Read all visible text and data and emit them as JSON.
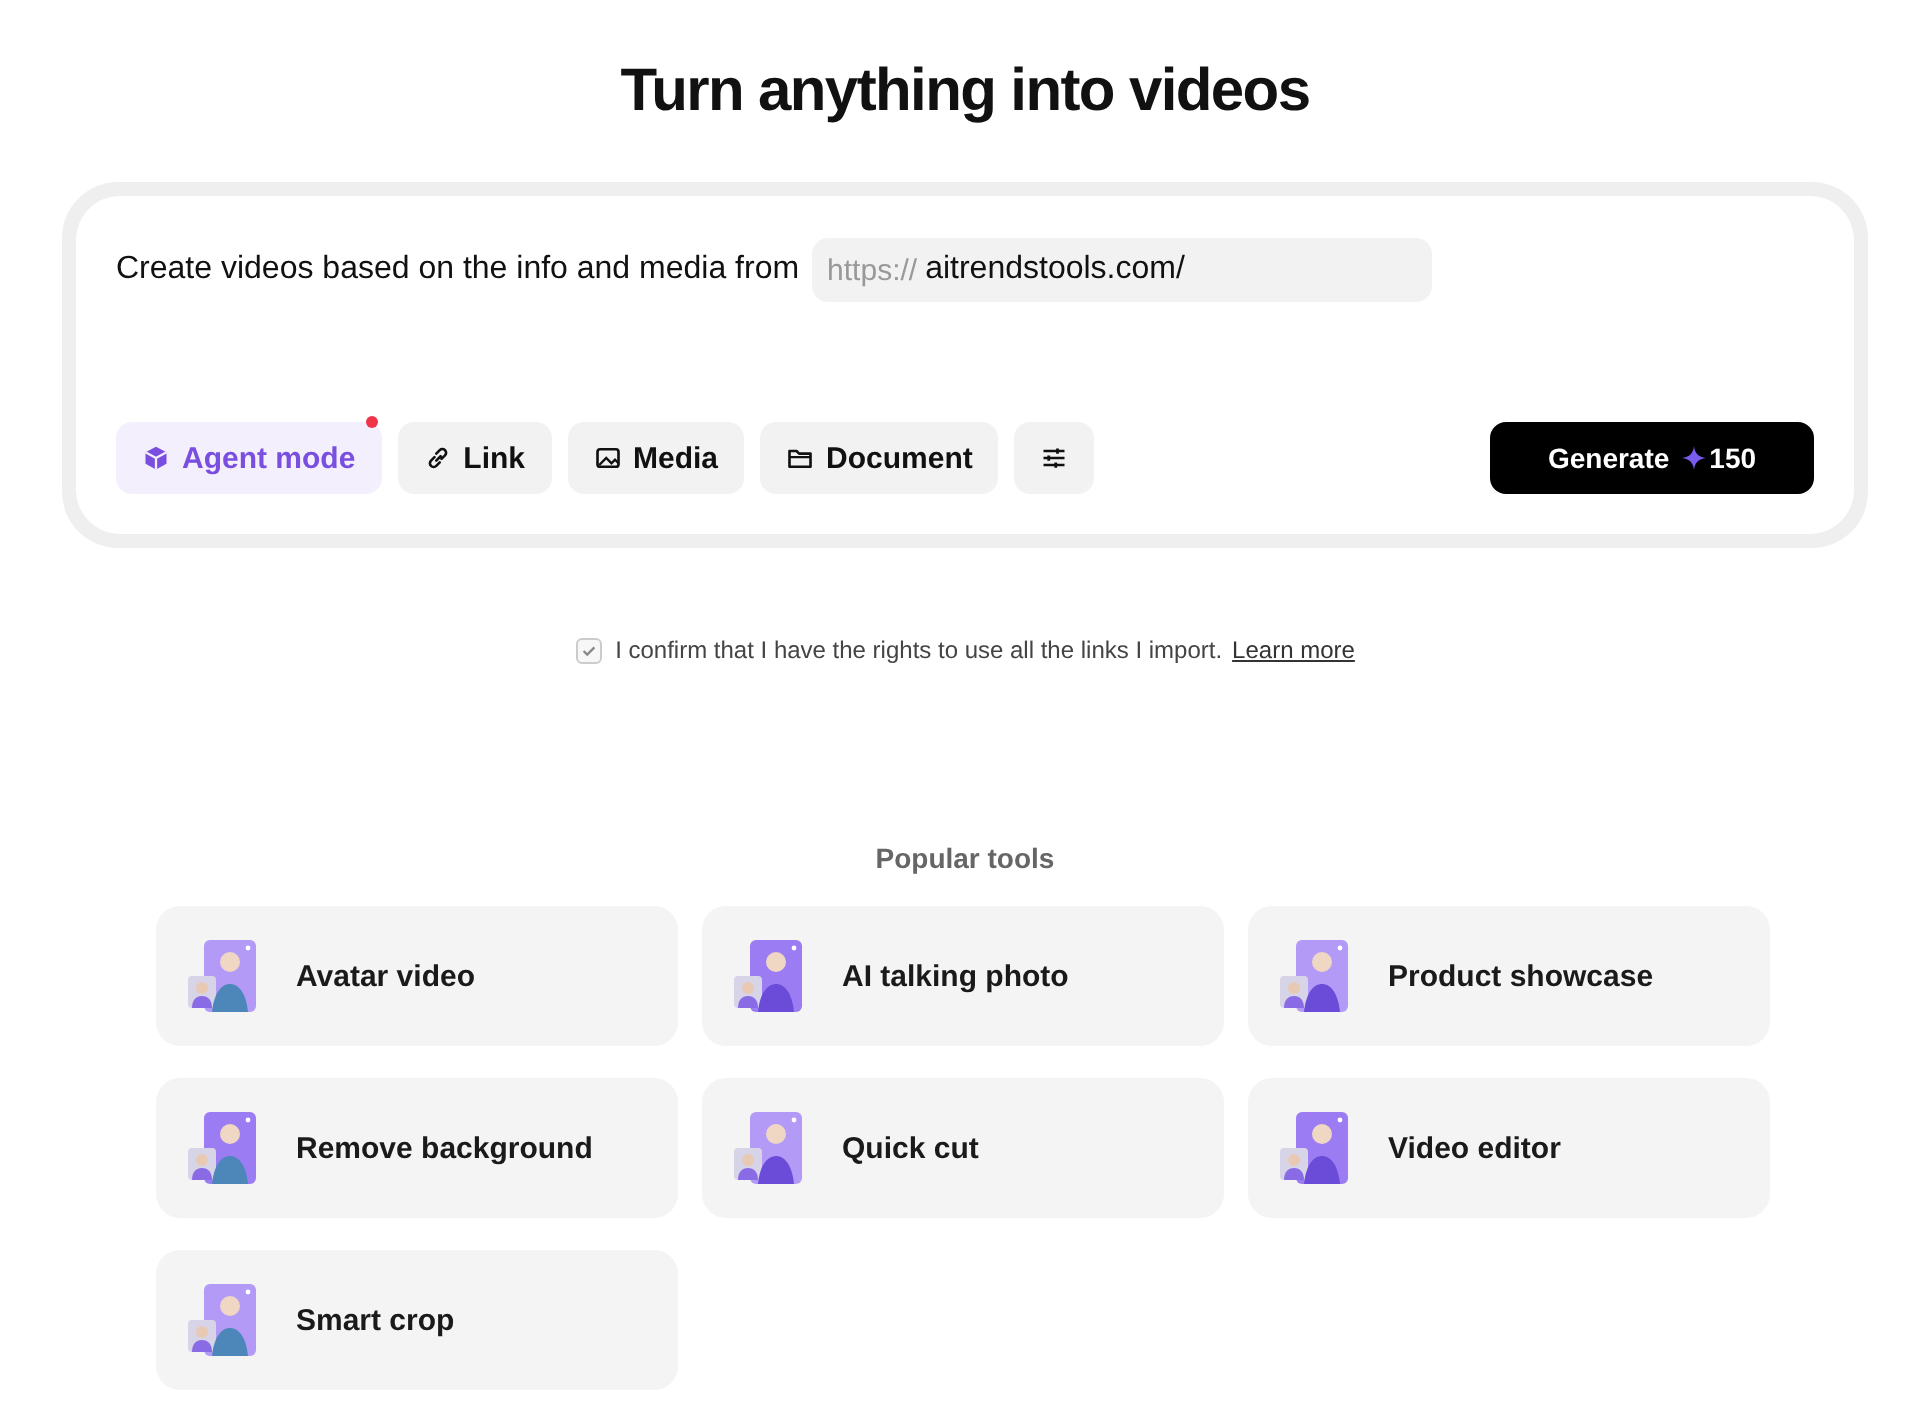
{
  "title": "Turn anything into videos",
  "prompt": {
    "text": "Create videos based on the info and media from",
    "url_prefix": "https://",
    "url_value": "aitrendstools.com/"
  },
  "toolbar": [
    {
      "kind": "agent",
      "label": "Agent mode",
      "selected": true,
      "notification": true
    },
    {
      "kind": "link",
      "label": "Link",
      "selected": false,
      "notification": false
    },
    {
      "kind": "media",
      "label": "Media",
      "selected": false,
      "notification": false
    },
    {
      "kind": "document",
      "label": "Document",
      "selected": false,
      "notification": false
    },
    {
      "kind": "settings",
      "selected": false,
      "notification": false
    }
  ],
  "generate": {
    "label": "Generate",
    "credits": "150"
  },
  "consent": {
    "checked": true,
    "text": "I confirm that I have the rights to use all the links I import.",
    "link": "Learn more"
  },
  "popular": {
    "heading": "Popular tools",
    "tools": [
      {
        "label": "Avatar video"
      },
      {
        "label": "AI talking photo"
      },
      {
        "label": "Product showcase"
      },
      {
        "label": "Remove background"
      },
      {
        "label": "Quick cut"
      },
      {
        "label": "Video editor"
      },
      {
        "label": "Smart crop"
      }
    ]
  }
}
